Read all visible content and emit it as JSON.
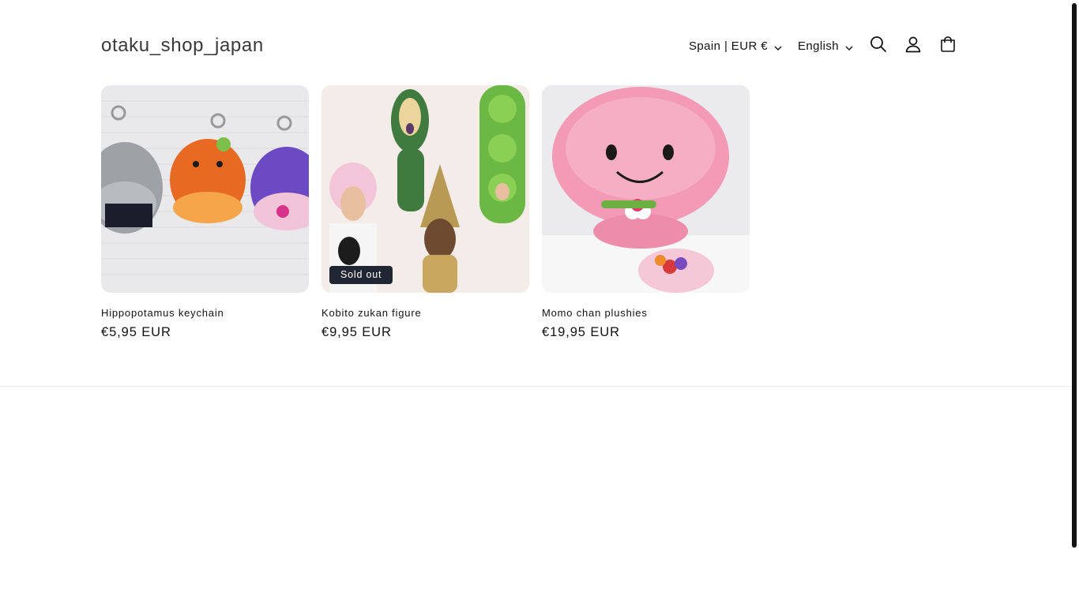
{
  "header": {
    "logo": "otaku_shop_japan",
    "country_selector": "Spain | EUR €",
    "language_selector": "English",
    "icons": [
      "search-icon",
      "account-icon",
      "cart-icon"
    ]
  },
  "products": [
    {
      "title": "Hippopotamus keychain",
      "price": "€5,95 EUR",
      "badge": ""
    },
    {
      "title": "Kobito zukan figure",
      "price": "€9,95 EUR",
      "badge": "Sold out"
    },
    {
      "title": "Momo chan plushies",
      "price": "€19,95 EUR",
      "badge": ""
    }
  ],
  "colors": {
    "text": "#121212",
    "badge_bg": "#202733",
    "divider": "#ececec"
  }
}
